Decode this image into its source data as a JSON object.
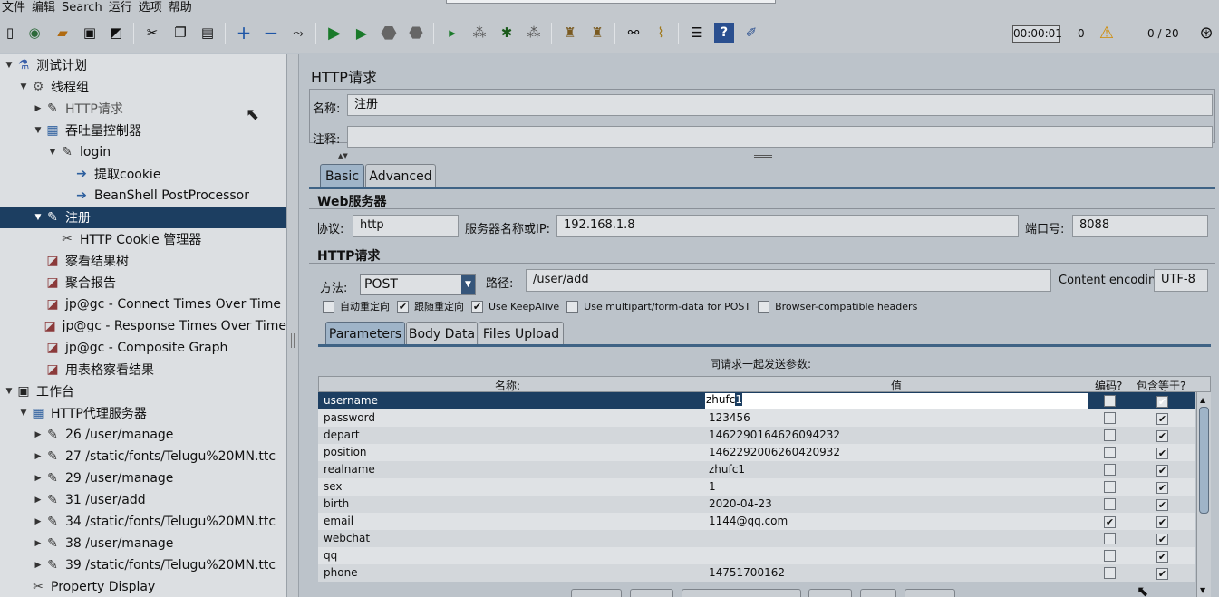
{
  "menu": [
    "文件",
    "编辑",
    "Search",
    "运行",
    "选项",
    "帮助"
  ],
  "toolbar": {
    "timer": "00:00:01",
    "warning_count": "0",
    "threads": "0 / 20"
  },
  "tree": [
    {
      "label": "测试计划",
      "icon": "test-plan-icon",
      "glyph": "⚗",
      "indent": 0,
      "twisty": "▼"
    },
    {
      "label": "线程组",
      "icon": "thread-group-icon",
      "glyph": "⚙",
      "indent": 1,
      "twisty": "▼"
    },
    {
      "label": "HTTP请求",
      "icon": "pipette-icon",
      "glyph": "✎",
      "indent": 2,
      "twisty": "▶",
      "dim": true
    },
    {
      "label": "吞吐量控制器",
      "icon": "controller-icon",
      "glyph": "▦",
      "indent": 2,
      "twisty": "▼"
    },
    {
      "label": "login",
      "icon": "pipette-icon",
      "glyph": "✎",
      "indent": 3,
      "twisty": "▼"
    },
    {
      "label": "提取cookie",
      "icon": "postprocessor-icon",
      "glyph": "➔",
      "indent": 4,
      "twisty": ""
    },
    {
      "label": "BeanShell PostProcessor",
      "icon": "postprocessor-icon",
      "glyph": "➔",
      "indent": 4,
      "twisty": ""
    },
    {
      "label": "注册",
      "icon": "pipette-icon",
      "glyph": "✎",
      "indent": 2,
      "twisty": "▼",
      "selected": true
    },
    {
      "label": "HTTP Cookie 管理器",
      "icon": "tools-icon",
      "glyph": "✂",
      "indent": 3,
      "twisty": ""
    },
    {
      "label": "察看结果树",
      "icon": "graph-icon",
      "glyph": "◪",
      "indent": 2,
      "twisty": ""
    },
    {
      "label": "聚合报告",
      "icon": "graph-icon",
      "glyph": "◪",
      "indent": 2,
      "twisty": ""
    },
    {
      "label": "jp@gc - Connect Times Over Time",
      "icon": "graph-icon",
      "glyph": "◪",
      "indent": 2,
      "twisty": ""
    },
    {
      "label": "jp@gc - Response Times Over Time",
      "icon": "graph-icon",
      "glyph": "◪",
      "indent": 2,
      "twisty": ""
    },
    {
      "label": "jp@gc - Composite Graph",
      "icon": "graph-icon",
      "glyph": "◪",
      "indent": 2,
      "twisty": ""
    },
    {
      "label": "用表格察看结果",
      "icon": "graph-icon",
      "glyph": "◪",
      "indent": 2,
      "twisty": ""
    },
    {
      "label": "工作台",
      "icon": "workbench-icon",
      "glyph": "▣",
      "indent": 0,
      "twisty": "▼"
    },
    {
      "label": "HTTP代理服务器",
      "icon": "controller-icon",
      "glyph": "▦",
      "indent": 1,
      "twisty": "▼"
    },
    {
      "label": "26 /user/manage",
      "icon": "pipette-icon",
      "glyph": "✎",
      "indent": 2,
      "twisty": "▶"
    },
    {
      "label": "27 /static/fonts/Telugu%20MN.ttc",
      "icon": "pipette-icon",
      "glyph": "✎",
      "indent": 2,
      "twisty": "▶"
    },
    {
      "label": "29 /user/manage",
      "icon": "pipette-icon",
      "glyph": "✎",
      "indent": 2,
      "twisty": "▶"
    },
    {
      "label": "31 /user/add",
      "icon": "pipette-icon",
      "glyph": "✎",
      "indent": 2,
      "twisty": "▶"
    },
    {
      "label": "34 /static/fonts/Telugu%20MN.ttc",
      "icon": "pipette-icon",
      "glyph": "✎",
      "indent": 2,
      "twisty": "▶"
    },
    {
      "label": "38 /user/manage",
      "icon": "pipette-icon",
      "glyph": "✎",
      "indent": 2,
      "twisty": "▶"
    },
    {
      "label": "39 /static/fonts/Telugu%20MN.ttc",
      "icon": "pipette-icon",
      "glyph": "✎",
      "indent": 2,
      "twisty": "▶"
    },
    {
      "label": "Property Display",
      "icon": "tools-icon",
      "glyph": "✂",
      "indent": 1,
      "twisty": ""
    }
  ],
  "panel": {
    "title": "HTTP请求",
    "name_label": "名称:",
    "name_value": "注册",
    "comment_label": "注释:",
    "comment_value": "",
    "tabs": [
      "Basic",
      "Advanced"
    ],
    "web_server_title": "Web服务器",
    "protocol_label": "协议:",
    "protocol_value": "http",
    "server_label": "服务器名称或IP:",
    "server_value": "192.168.1.8",
    "port_label": "端口号:",
    "port_value": "8088",
    "http_request_title": "HTTP请求",
    "method_label": "方法:",
    "method_value": "POST",
    "path_label": "路径:",
    "path_value": "/user/add",
    "encoding_label": "Content encoding:",
    "encoding_value": "UTF-8",
    "checkboxes": [
      {
        "label": "自动重定向",
        "checked": false
      },
      {
        "label": "跟随重定向",
        "checked": true
      },
      {
        "label": "Use KeepAlive",
        "checked": true
      },
      {
        "label": "Use multipart/form-data for POST",
        "checked": false
      },
      {
        "label": "Browser-compatible headers",
        "checked": false
      }
    ],
    "subtabs": [
      "Parameters",
      "Body Data",
      "Files Upload"
    ],
    "params_caption": "同请求一起发送参数:",
    "columns": {
      "name": "名称:",
      "value": "值",
      "encode": "编码?",
      "include_equals": "包含等于?"
    },
    "params": [
      {
        "name": "username",
        "value": "zhufc1",
        "encode": false,
        "include": true,
        "selected": true
      },
      {
        "name": "password",
        "value": "123456",
        "encode": false,
        "include": true
      },
      {
        "name": "depart",
        "value": "1462290164626094232",
        "encode": false,
        "include": true
      },
      {
        "name": "position",
        "value": "1462292006260420932",
        "encode": false,
        "include": true
      },
      {
        "name": "realname",
        "value": "zhufc1",
        "encode": false,
        "include": true
      },
      {
        "name": "sex",
        "value": "1",
        "encode": false,
        "include": true
      },
      {
        "name": "birth",
        "value": "2020-04-23",
        "encode": false,
        "include": true
      },
      {
        "name": "email",
        "value": "1144@qq.com",
        "encode": true,
        "include": true
      },
      {
        "name": "webchat",
        "value": "",
        "encode": false,
        "include": true
      },
      {
        "name": "qq",
        "value": "",
        "encode": false,
        "include": true
      },
      {
        "name": "phone",
        "value": "14751700162",
        "encode": false,
        "include": true
      }
    ]
  }
}
